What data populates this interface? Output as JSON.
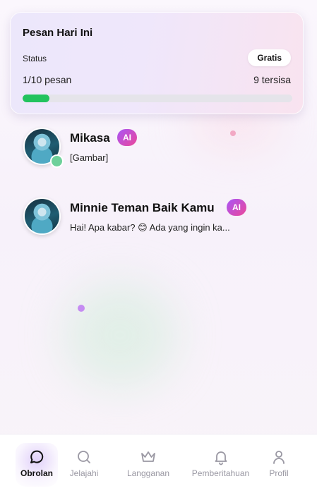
{
  "quota": {
    "title": "Pesan Hari Ini",
    "status_label": "Status",
    "status_badge": "Gratis",
    "used_text": "1/10 pesan",
    "remaining_text": "9 tersisa",
    "used": 1,
    "limit": 10,
    "progress_color": "#22c35e"
  },
  "chats": [
    {
      "name": "Mikasa",
      "badge": "AI",
      "preview": "[Gambar]",
      "online": true
    },
    {
      "name": "Minnie Teman Baik Kamu",
      "badge": "AI",
      "preview": "Hai! Apa kabar? 😊 Ada yang ingin ka...",
      "online": false
    }
  ],
  "nav": {
    "items": [
      {
        "label": "Obrolan",
        "icon": "chat-bubble-icon",
        "active": true
      },
      {
        "label": "Jelajahi",
        "icon": "search-icon",
        "active": false
      },
      {
        "label": "Langganan",
        "icon": "crown-icon",
        "active": false
      },
      {
        "label": "Pemberitahuan",
        "icon": "bell-icon",
        "active": false
      },
      {
        "label": "Profil",
        "icon": "user-icon",
        "active": false
      }
    ]
  },
  "colors": {
    "accent": "#a855f7",
    "badge_gradient_end": "#ec4899",
    "online": "#6dd09a"
  }
}
